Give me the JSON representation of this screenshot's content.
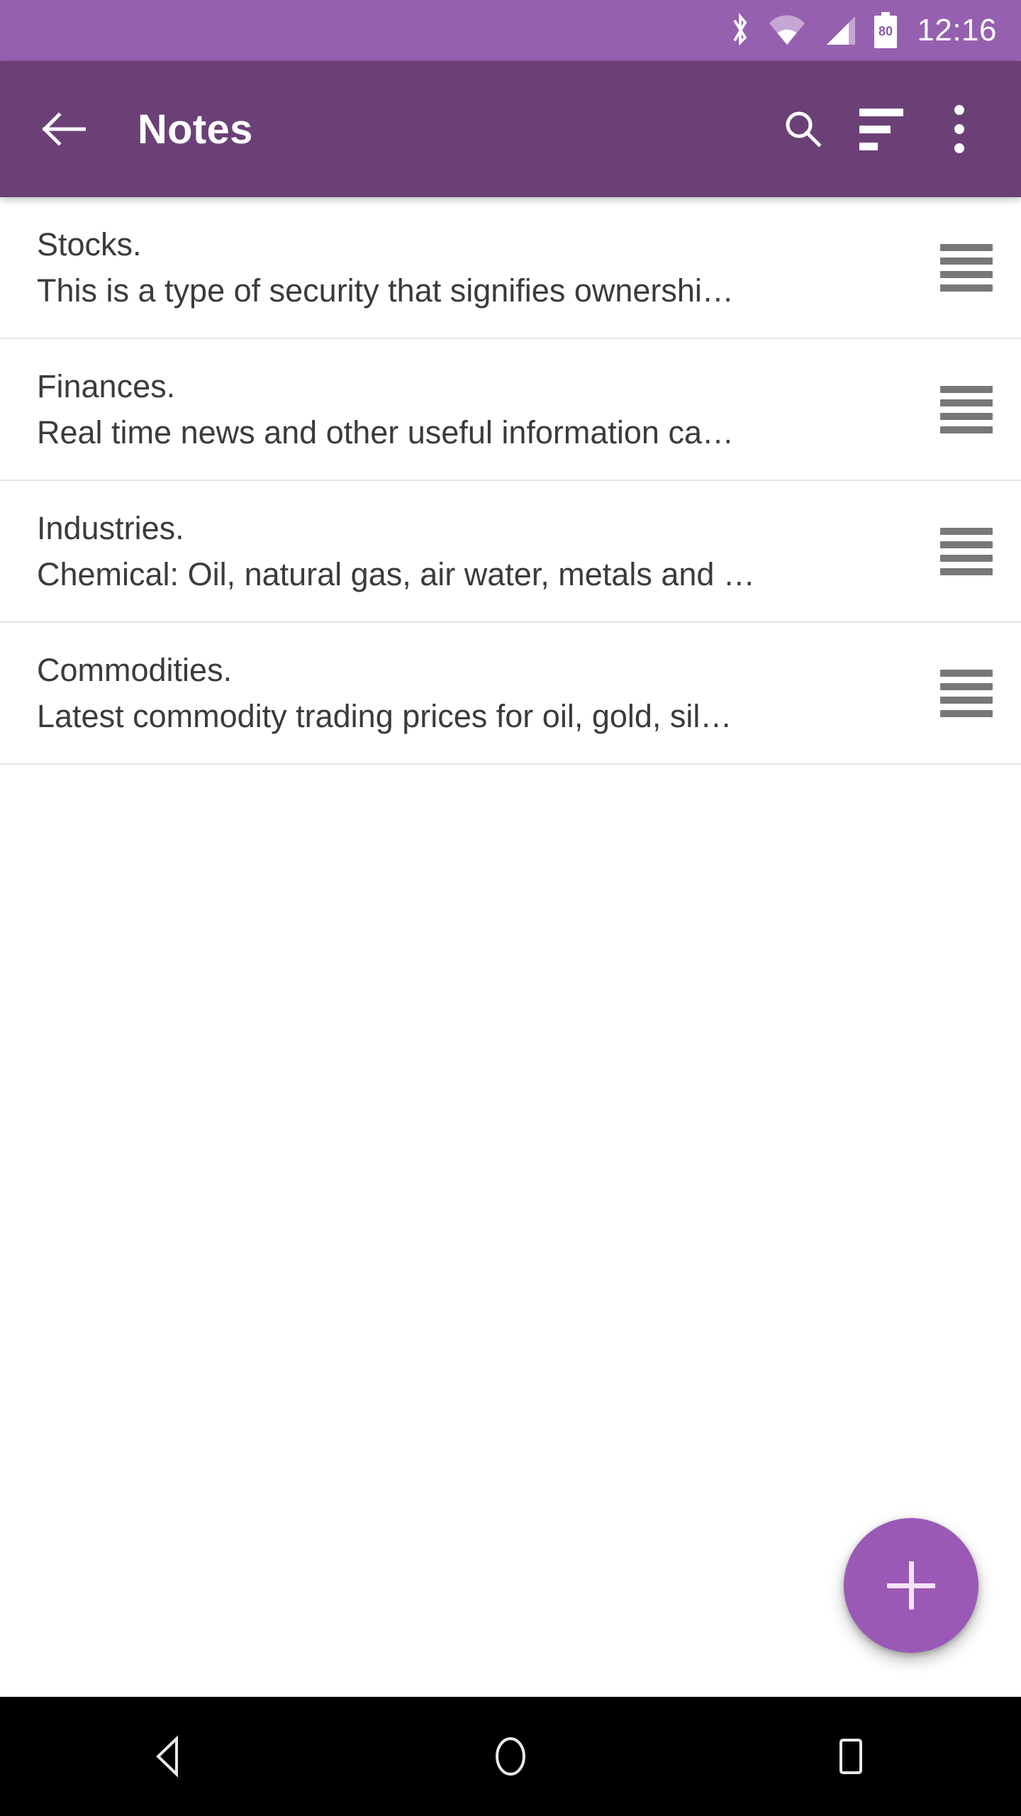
{
  "status_bar": {
    "time": "12:16",
    "battery_level": "80",
    "icons": [
      "bluetooth-icon",
      "wifi-icon",
      "cellular-signal-icon",
      "battery-icon"
    ],
    "background_color": "#9560b0",
    "foreground_color": "#ffffff"
  },
  "app_bar": {
    "title": "Notes",
    "background_color": "#6b4077",
    "back_label": "Back",
    "actions": [
      {
        "name": "search",
        "label": "Search"
      },
      {
        "name": "sort",
        "label": "Sort"
      },
      {
        "name": "more-options",
        "label": "More options"
      }
    ]
  },
  "notes": [
    {
      "title": "Stocks.",
      "snippet": "This is a type of security that signifies ownershi…"
    },
    {
      "title": "Finances.",
      "snippet": "Real time news and other useful information ca…"
    },
    {
      "title": "Industries.",
      "snippet": "Chemical: Oil, natural gas, air water, metals and …"
    },
    {
      "title": "Commodities.",
      "snippet": "Latest commodity trading prices for oil, gold, sil…"
    }
  ],
  "fab": {
    "label": "Add note",
    "glyph": "+",
    "color": "#9b59b6"
  },
  "nav_bar": {
    "background_color": "#000000",
    "buttons": [
      {
        "name": "back",
        "label": "Back"
      },
      {
        "name": "home",
        "label": "Home"
      },
      {
        "name": "recents",
        "label": "Recent apps"
      }
    ]
  }
}
